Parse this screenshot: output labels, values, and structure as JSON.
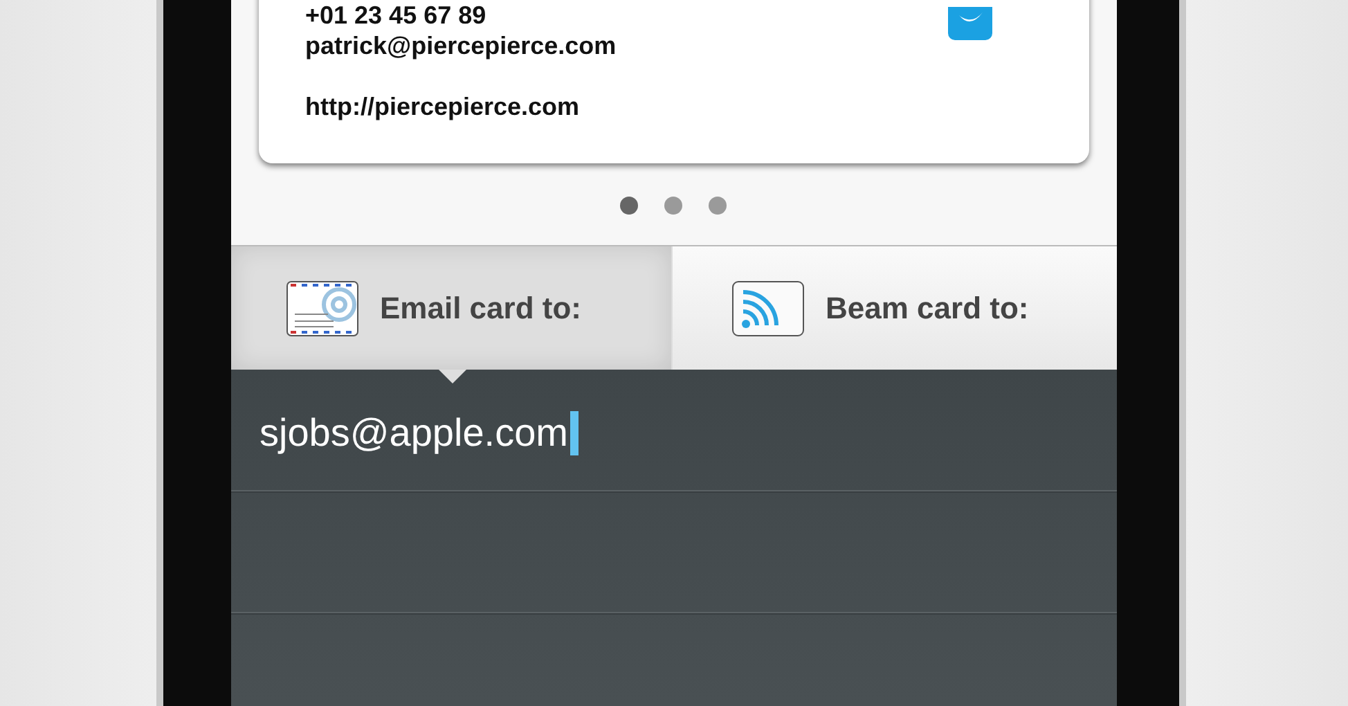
{
  "card": {
    "phone": "+01 23 45 67 89",
    "email": "patrick@piercepierce.com",
    "website": "http://piercepierce.com"
  },
  "pager": [
    {
      "selected": true
    },
    {
      "selected": false
    },
    {
      "selected": false
    }
  ],
  "tabs": [
    {
      "kind": "email",
      "label": "Email card to:",
      "selected": true
    },
    {
      "kind": "beam",
      "label": "Beam card to:",
      "selected": false
    }
  ],
  "recipient": {
    "value": "sjobs@apple.com"
  }
}
